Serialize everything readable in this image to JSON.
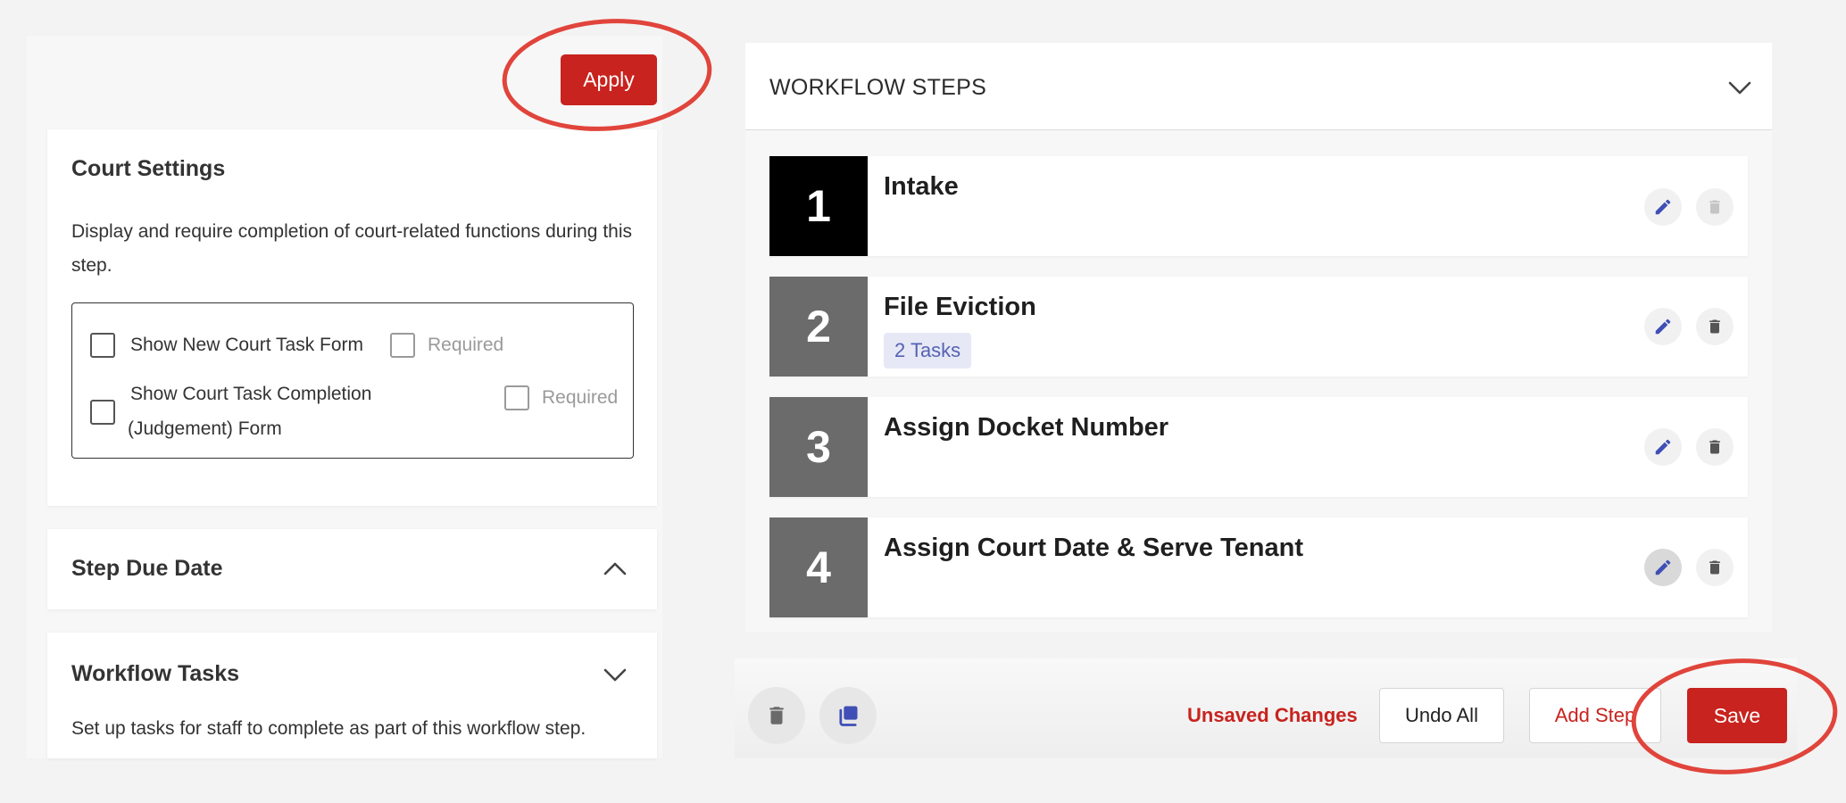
{
  "apply": {
    "label": "Apply"
  },
  "court_settings": {
    "title": "Court Settings",
    "description": "Display and require completion of court-related functions during this step.",
    "options": [
      {
        "label": "Show New Court Task Form",
        "required_label": "Required"
      },
      {
        "label_line1": "Show Court Task Completion",
        "label_line2": "(Judgement) Form",
        "required_label": "Required"
      }
    ]
  },
  "step_due_date": {
    "title": "Step Due Date"
  },
  "workflow_tasks": {
    "title": "Workflow Tasks",
    "description": "Set up tasks for staff to complete as part of this workflow step."
  },
  "workflow_steps": {
    "title": "WORKFLOW STEPS",
    "steps": [
      {
        "number": "1",
        "title": "Intake",
        "color": "#000000"
      },
      {
        "number": "2",
        "title": "File Eviction",
        "badge": "2 Tasks",
        "color": "#6b6b6b"
      },
      {
        "number": "3",
        "title": "Assign Docket Number",
        "color": "#6b6b6b"
      },
      {
        "number": "4",
        "title": "Assign Court Date & Serve Tenant",
        "color": "#6b6b6b"
      }
    ]
  },
  "footer": {
    "unsaved": "Unsaved Changes",
    "undo_all": "Undo All",
    "add_step": "Add Step",
    "save": "Save"
  },
  "colors": {
    "accent": "#c8231e",
    "edit_icon": "#3f4fb5",
    "annotation": "#e0443b"
  }
}
